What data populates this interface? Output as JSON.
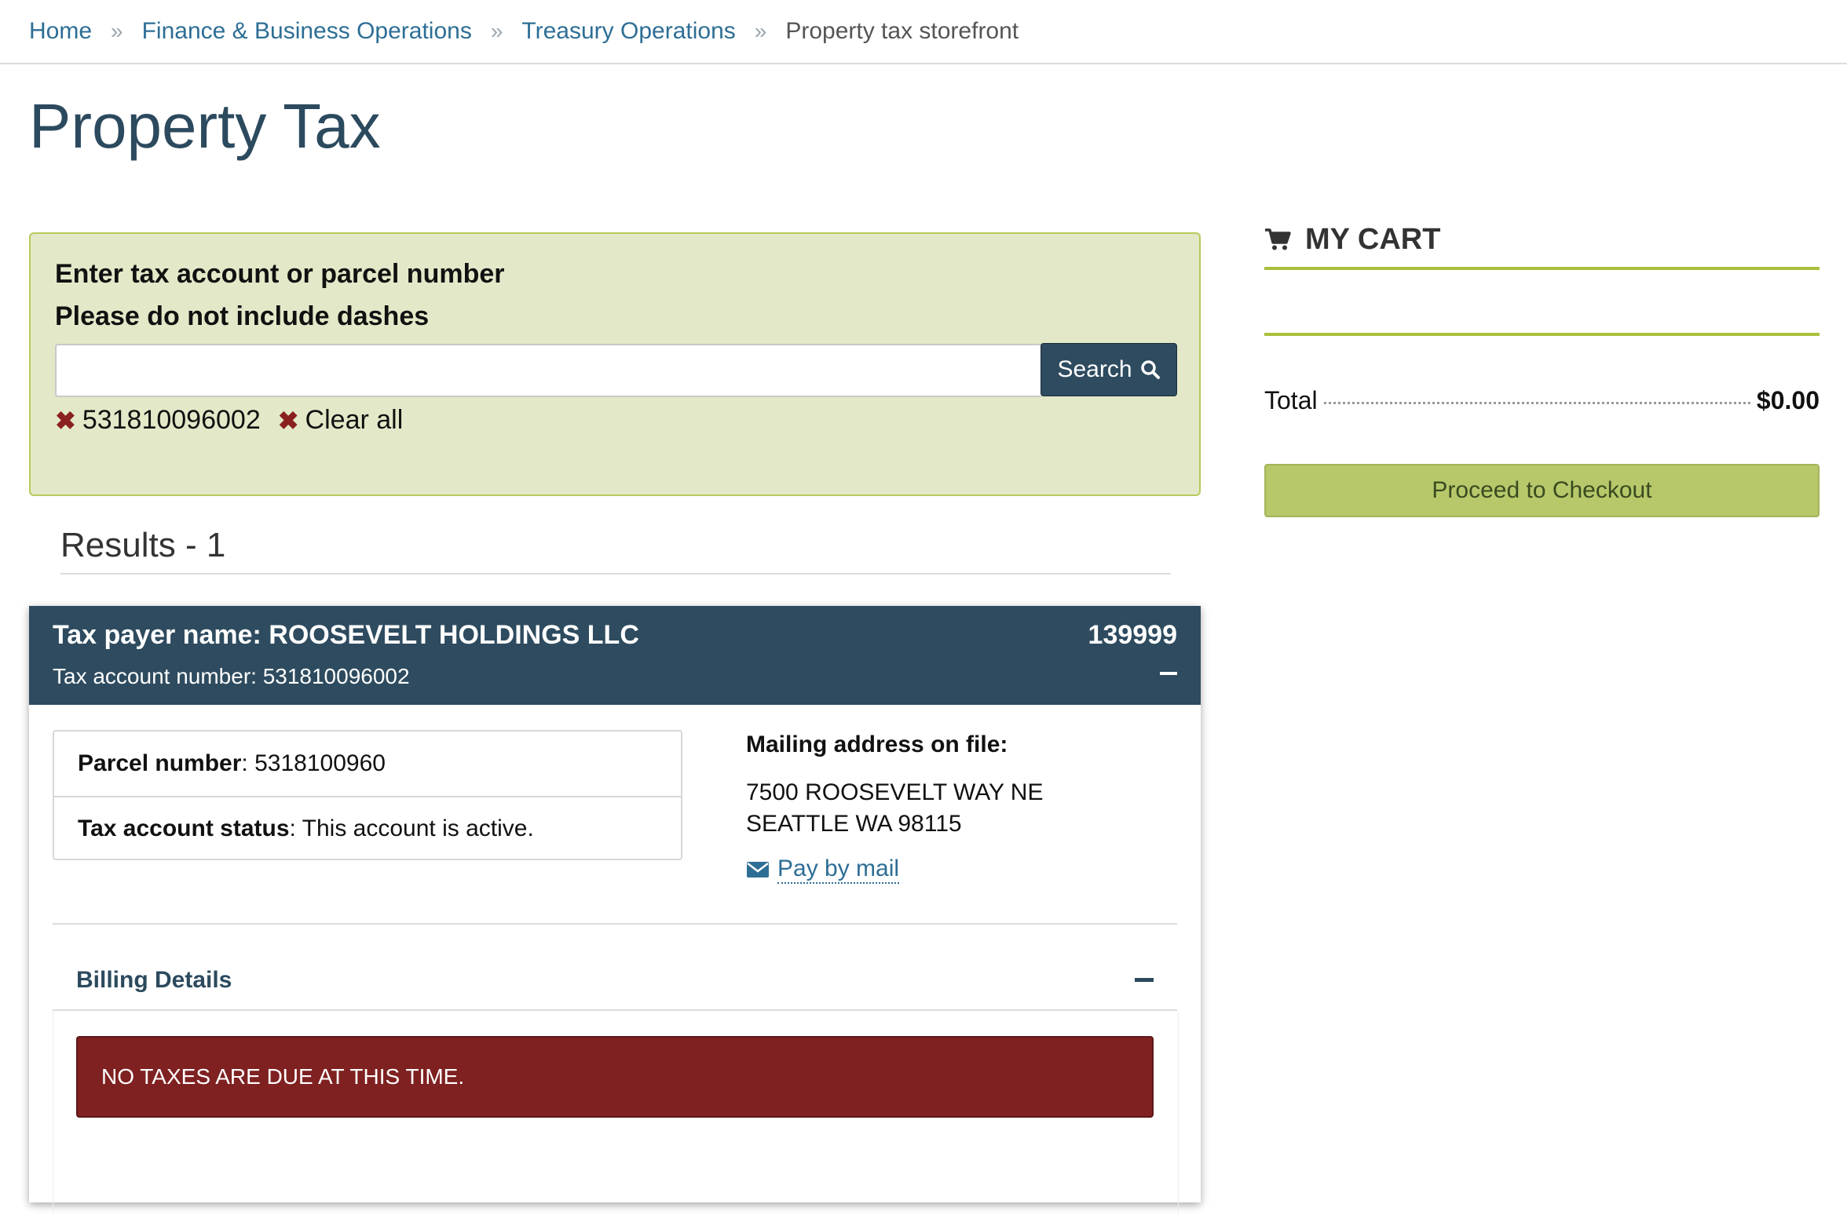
{
  "breadcrumb": {
    "items": [
      "Home",
      "Finance & Business Operations",
      "Treasury Operations"
    ],
    "current": "Property tax storefront",
    "separator": "»"
  },
  "page_title": "Property Tax",
  "search": {
    "label_line1": "Enter tax account or parcel number",
    "label_line2": "Please do not include dashes",
    "value": "",
    "button_label": "Search",
    "filters": [
      "531810096002"
    ],
    "clear_all_label": "Clear all"
  },
  "results": {
    "heading": "Results - 1",
    "card": {
      "taxpayer_label": "Tax payer name: ROOSEVELT HOLDINGS LLC",
      "record_number": "139999",
      "account_label": "Tax account number: 531810096002",
      "parcel_label": "Parcel number",
      "parcel_value": ": 5318100960",
      "status_label": "Tax account status",
      "status_value": ": This account is active.",
      "mailing_heading": "Mailing address on file:",
      "address_line1": "7500 ROOSEVELT WAY NE",
      "address_line2": "SEATTLE WA 98115",
      "pay_by_mail": "Pay by mail",
      "billing_title": "Billing Details",
      "alert": "NO TAXES ARE DUE AT THIS TIME."
    }
  },
  "cart": {
    "title": "MY CART",
    "total_label": "Total",
    "total_value": "$0.00",
    "checkout_label": "Proceed to Checkout"
  },
  "colors": {
    "primary": "#2e4b5f",
    "accent_green": "#a9bf3b",
    "panel_bg": "#e3e9c8",
    "alert_red": "#7f2121",
    "link": "#2d6e95"
  }
}
